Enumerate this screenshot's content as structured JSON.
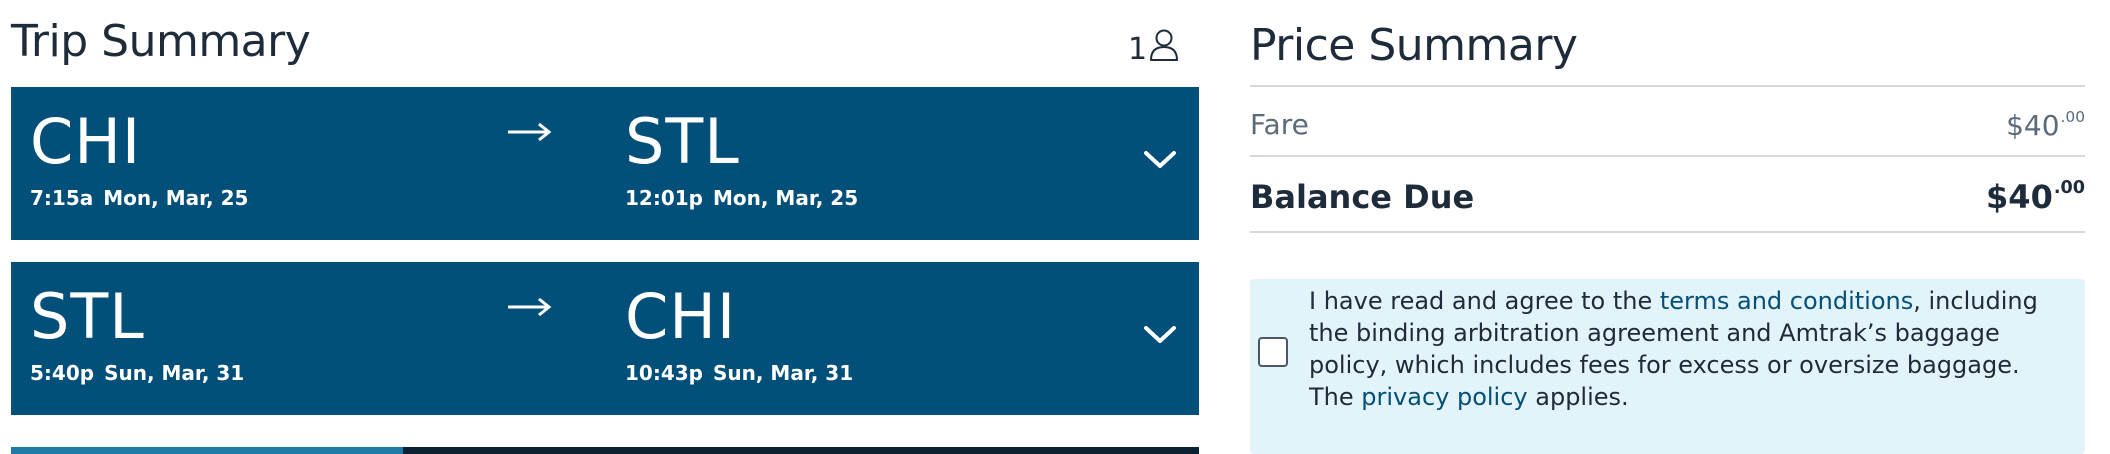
{
  "trip": {
    "title": "Trip Summary",
    "passenger_count": "1",
    "legs": [
      {
        "origin": "CHI",
        "origin_time": "7:15a",
        "origin_date": "Mon, Mar, 25",
        "destination": "STL",
        "destination_time": "12:01p",
        "destination_date": "Mon, Mar, 25"
      },
      {
        "origin": "STL",
        "origin_time": "5:40p",
        "origin_date": "Sun, Mar, 31",
        "destination": "CHI",
        "destination_time": "10:43p",
        "destination_date": "Sun, Mar, 31"
      }
    ],
    "progress_fraction": 0.33
  },
  "price": {
    "title": "Price Summary",
    "fare_label": "Fare",
    "fare_dollars": "$40",
    "fare_cents": ".00",
    "balance_label": "Balance Due",
    "balance_dollars": "$40",
    "balance_cents": ".00"
  },
  "agreement": {
    "text_1": "I have read and agree to the ",
    "terms_link": "terms and conditions",
    "text_2": ", including the binding arbitration agreement and Amtrak’s baggage policy, which includes fees for excess or oversize baggage. The ",
    "privacy_link": "privacy policy",
    "text_3": " applies."
  },
  "colors": {
    "leg_background": "#02507a",
    "agreement_background": "#e2f3fa",
    "link": "#02507a"
  },
  "icons": [
    "person-icon",
    "arrow-right-icon",
    "chevron-down-icon"
  ]
}
